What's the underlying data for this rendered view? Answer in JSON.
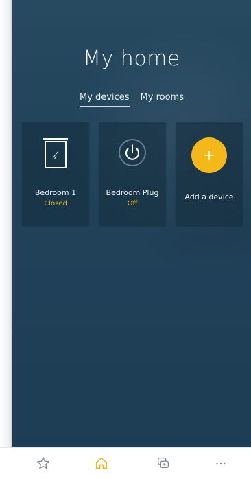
{
  "header": {
    "title": "My home"
  },
  "tabs": [
    {
      "label": "My devices",
      "active": true
    },
    {
      "label": "My rooms",
      "active": false
    }
  ],
  "devices": [
    {
      "name": "Bedroom 1",
      "status": "Closed",
      "icon": "window-blind-icon"
    },
    {
      "name": "Bedroom Plug",
      "status": "Off",
      "icon": "power-icon"
    }
  ],
  "add_device": {
    "label": "Add a device",
    "icon": "plus-icon"
  },
  "bottom_nav": [
    {
      "icon": "star-icon",
      "active": false
    },
    {
      "icon": "home-icon",
      "active": true
    },
    {
      "icon": "scenes-icon",
      "active": false
    },
    {
      "icon": "more-icon",
      "active": false
    }
  ],
  "colors": {
    "accent": "#f5b81a",
    "status": "#f2b21b",
    "background": "#21435a",
    "card": "#1f3b4f"
  }
}
